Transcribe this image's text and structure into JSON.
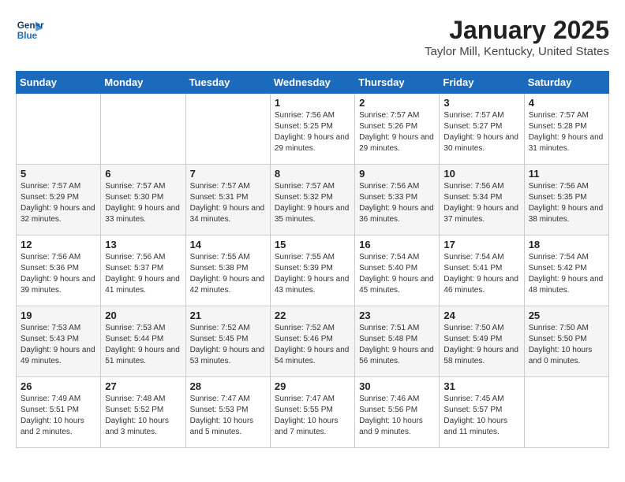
{
  "header": {
    "logo": "GeneralBlue",
    "title": "January 2025",
    "location": "Taylor Mill, Kentucky, United States"
  },
  "days_of_week": [
    "Sunday",
    "Monday",
    "Tuesday",
    "Wednesday",
    "Thursday",
    "Friday",
    "Saturday"
  ],
  "weeks": [
    [
      {
        "day": "",
        "info": ""
      },
      {
        "day": "",
        "info": ""
      },
      {
        "day": "",
        "info": ""
      },
      {
        "day": "1",
        "info": "Sunrise: 7:56 AM\nSunset: 5:25 PM\nDaylight: 9 hours and 29 minutes."
      },
      {
        "day": "2",
        "info": "Sunrise: 7:57 AM\nSunset: 5:26 PM\nDaylight: 9 hours and 29 minutes."
      },
      {
        "day": "3",
        "info": "Sunrise: 7:57 AM\nSunset: 5:27 PM\nDaylight: 9 hours and 30 minutes."
      },
      {
        "day": "4",
        "info": "Sunrise: 7:57 AM\nSunset: 5:28 PM\nDaylight: 9 hours and 31 minutes."
      }
    ],
    [
      {
        "day": "5",
        "info": "Sunrise: 7:57 AM\nSunset: 5:29 PM\nDaylight: 9 hours and 32 minutes."
      },
      {
        "day": "6",
        "info": "Sunrise: 7:57 AM\nSunset: 5:30 PM\nDaylight: 9 hours and 33 minutes."
      },
      {
        "day": "7",
        "info": "Sunrise: 7:57 AM\nSunset: 5:31 PM\nDaylight: 9 hours and 34 minutes."
      },
      {
        "day": "8",
        "info": "Sunrise: 7:57 AM\nSunset: 5:32 PM\nDaylight: 9 hours and 35 minutes."
      },
      {
        "day": "9",
        "info": "Sunrise: 7:56 AM\nSunset: 5:33 PM\nDaylight: 9 hours and 36 minutes."
      },
      {
        "day": "10",
        "info": "Sunrise: 7:56 AM\nSunset: 5:34 PM\nDaylight: 9 hours and 37 minutes."
      },
      {
        "day": "11",
        "info": "Sunrise: 7:56 AM\nSunset: 5:35 PM\nDaylight: 9 hours and 38 minutes."
      }
    ],
    [
      {
        "day": "12",
        "info": "Sunrise: 7:56 AM\nSunset: 5:36 PM\nDaylight: 9 hours and 39 minutes."
      },
      {
        "day": "13",
        "info": "Sunrise: 7:56 AM\nSunset: 5:37 PM\nDaylight: 9 hours and 41 minutes."
      },
      {
        "day": "14",
        "info": "Sunrise: 7:55 AM\nSunset: 5:38 PM\nDaylight: 9 hours and 42 minutes."
      },
      {
        "day": "15",
        "info": "Sunrise: 7:55 AM\nSunset: 5:39 PM\nDaylight: 9 hours and 43 minutes."
      },
      {
        "day": "16",
        "info": "Sunrise: 7:54 AM\nSunset: 5:40 PM\nDaylight: 9 hours and 45 minutes."
      },
      {
        "day": "17",
        "info": "Sunrise: 7:54 AM\nSunset: 5:41 PM\nDaylight: 9 hours and 46 minutes."
      },
      {
        "day": "18",
        "info": "Sunrise: 7:54 AM\nSunset: 5:42 PM\nDaylight: 9 hours and 48 minutes."
      }
    ],
    [
      {
        "day": "19",
        "info": "Sunrise: 7:53 AM\nSunset: 5:43 PM\nDaylight: 9 hours and 49 minutes."
      },
      {
        "day": "20",
        "info": "Sunrise: 7:53 AM\nSunset: 5:44 PM\nDaylight: 9 hours and 51 minutes."
      },
      {
        "day": "21",
        "info": "Sunrise: 7:52 AM\nSunset: 5:45 PM\nDaylight: 9 hours and 53 minutes."
      },
      {
        "day": "22",
        "info": "Sunrise: 7:52 AM\nSunset: 5:46 PM\nDaylight: 9 hours and 54 minutes."
      },
      {
        "day": "23",
        "info": "Sunrise: 7:51 AM\nSunset: 5:48 PM\nDaylight: 9 hours and 56 minutes."
      },
      {
        "day": "24",
        "info": "Sunrise: 7:50 AM\nSunset: 5:49 PM\nDaylight: 9 hours and 58 minutes."
      },
      {
        "day": "25",
        "info": "Sunrise: 7:50 AM\nSunset: 5:50 PM\nDaylight: 10 hours and 0 minutes."
      }
    ],
    [
      {
        "day": "26",
        "info": "Sunrise: 7:49 AM\nSunset: 5:51 PM\nDaylight: 10 hours and 2 minutes."
      },
      {
        "day": "27",
        "info": "Sunrise: 7:48 AM\nSunset: 5:52 PM\nDaylight: 10 hours and 3 minutes."
      },
      {
        "day": "28",
        "info": "Sunrise: 7:47 AM\nSunset: 5:53 PM\nDaylight: 10 hours and 5 minutes."
      },
      {
        "day": "29",
        "info": "Sunrise: 7:47 AM\nSunset: 5:55 PM\nDaylight: 10 hours and 7 minutes."
      },
      {
        "day": "30",
        "info": "Sunrise: 7:46 AM\nSunset: 5:56 PM\nDaylight: 10 hours and 9 minutes."
      },
      {
        "day": "31",
        "info": "Sunrise: 7:45 AM\nSunset: 5:57 PM\nDaylight: 10 hours and 11 minutes."
      },
      {
        "day": "",
        "info": ""
      }
    ]
  ]
}
